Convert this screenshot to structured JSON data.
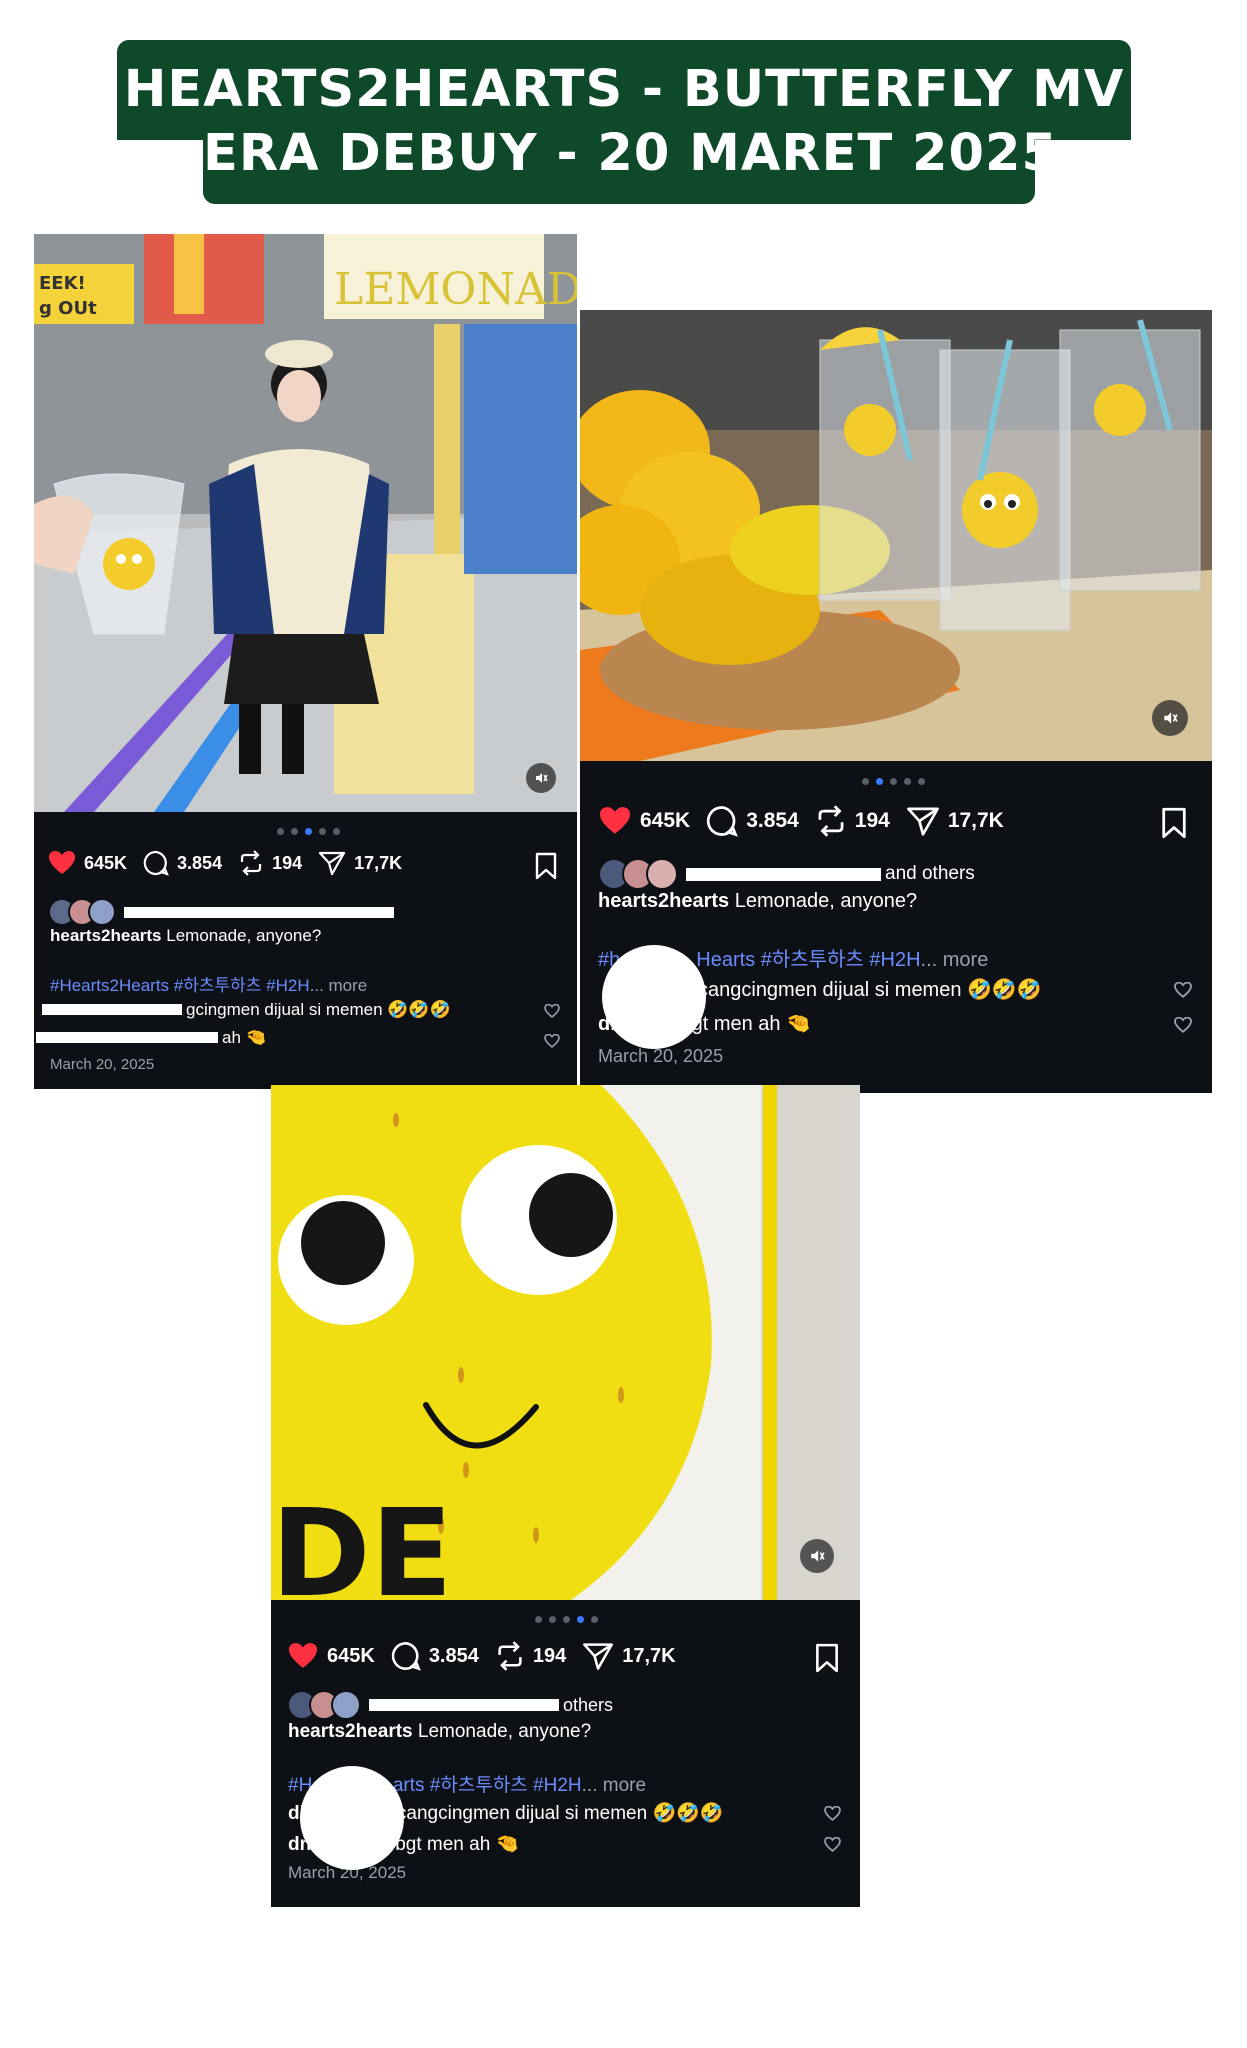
{
  "title": {
    "line1": "HEARTS2HEARTS - BUTTERFLY MV",
    "line2": "ERA DEBUY - 20 MARET 2025"
  },
  "colors": {
    "banner": "#0e4a2a",
    "post_bg": "#0d1014",
    "like_red": "#ff3040",
    "hashtag_blue": "#6b8cff",
    "active_dot": "#3a7bff"
  },
  "posts": [
    {
      "likes": "645K",
      "comments": "3.854",
      "reposts": "194",
      "shares": "17,7K",
      "caption_user": "hearts2hearts",
      "caption_text": "Lemonade, anyone?",
      "hashtags": "#Hearts2Hearts #하츠투하츠 #H2H",
      "more": "... more",
      "comment1": "gcingmen dijual si memen 🤣🤣🤣",
      "comment2": "ah 🤏",
      "date": "March 20, 2025",
      "image_sign": "LEMONADE",
      "image_banner": "EEK! g OUt",
      "carousel_active": 2
    },
    {
      "likes": "645K",
      "comments": "3.854",
      "reposts": "194",
      "shares": "17,7K",
      "liked_suffix": "and others",
      "caption_user": "hearts2hearts",
      "caption_text": "Lemonade, anyone?",
      "hashtags_prefix": "#h",
      "hashtags": "Hearts #하츠투하츠 #H2H",
      "more": "... more",
      "comment1": "cangcingmen dijual si memen 🤣🤣🤣",
      "comment2_user": "di",
      "comment2": "u bgt men ah 🤏",
      "date": "March 20, 2025",
      "carousel_active": 1
    },
    {
      "likes": "645K",
      "comments": "3.854",
      "reposts": "194",
      "shares": "17,7K",
      "liked_suffix": "others",
      "caption_user": "hearts2hearts",
      "caption_text": "Lemonade, anyone?",
      "hashtags_prefix": "#He",
      "hashtags": "arts #하츠투하츠 #H2H",
      "more": "... more",
      "comment1_user": "di",
      "comment1": "cangcingmen dijual si memen 🤣🤣🤣",
      "comment2_user": "dn",
      "comment2": "bgt men ah 🤏",
      "date": "March 20, 2025",
      "image_sign": "DE",
      "carousel_active": 3
    }
  ]
}
